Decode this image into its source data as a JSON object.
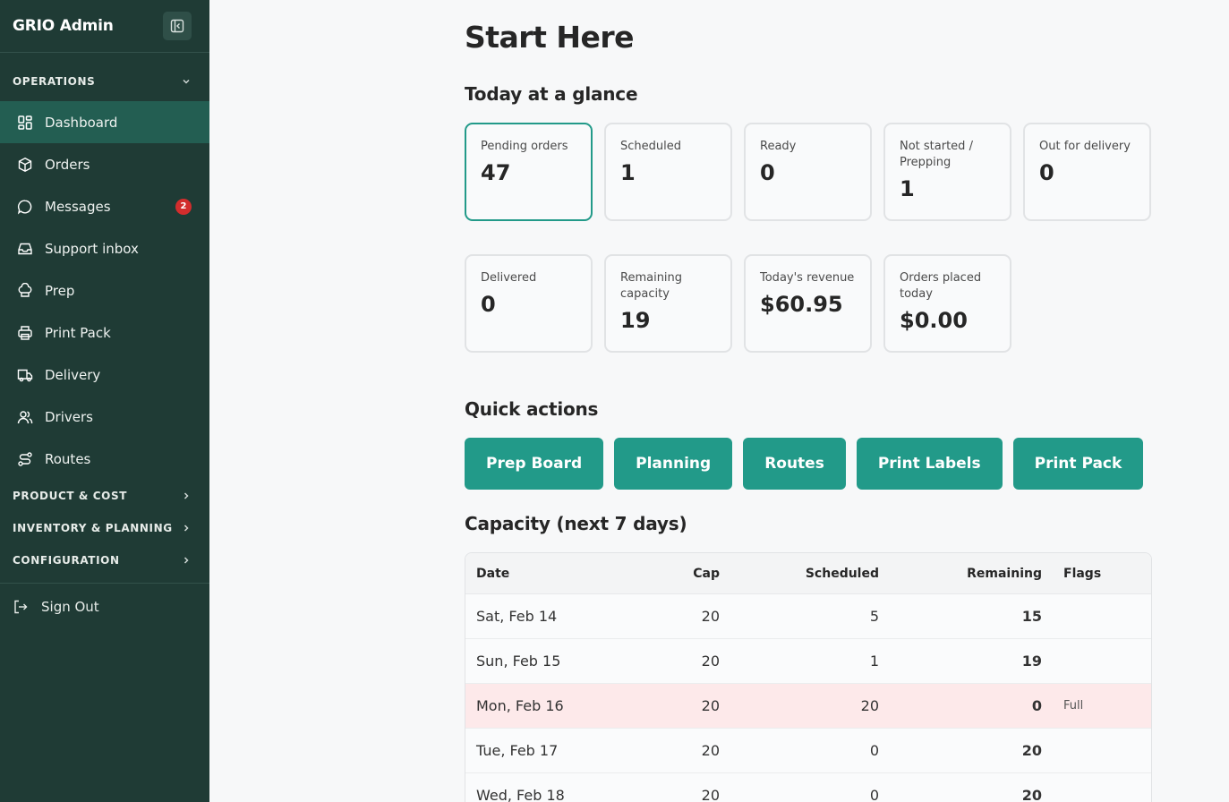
{
  "sidebar": {
    "brand": "GRIO Admin",
    "operations_label": "OPERATIONS",
    "items": [
      {
        "label": "Dashboard",
        "icon": "dashboard-icon"
      },
      {
        "label": "Orders",
        "icon": "box-icon"
      },
      {
        "label": "Messages",
        "icon": "chat-icon",
        "badge": "2"
      },
      {
        "label": "Support inbox",
        "icon": "inbox-icon"
      },
      {
        "label": "Prep",
        "icon": "chef-hat-icon"
      },
      {
        "label": "Print Pack",
        "icon": "printer-icon"
      },
      {
        "label": "Delivery",
        "icon": "truck-icon"
      },
      {
        "label": "Drivers",
        "icon": "users-icon"
      },
      {
        "label": "Routes",
        "icon": "route-icon"
      }
    ],
    "sections": [
      "PRODUCT & COST",
      "INVENTORY & PLANNING",
      "CONFIGURATION"
    ],
    "sign_out": "Sign Out",
    "active_color": "#235e52"
  },
  "page": {
    "title": "Start Here",
    "glance_heading": "Today at a glance",
    "cards": [
      {
        "label": "Pending orders",
        "value": "47"
      },
      {
        "label": "Scheduled",
        "value": "1"
      },
      {
        "label": "Ready",
        "value": "0"
      },
      {
        "label": "Not started / Prepping",
        "value": "1"
      },
      {
        "label": "Out for delivery",
        "value": "0"
      },
      {
        "label": "Delivered",
        "value": "0"
      },
      {
        "label": "Remaining capacity",
        "value": "19"
      },
      {
        "label": "Today's revenue",
        "value": "$60.95"
      },
      {
        "label": "Orders placed today",
        "value": "$0.00"
      }
    ],
    "quick_actions_heading": "Quick actions",
    "actions": [
      "Prep Board",
      "Planning",
      "Routes",
      "Print Labels",
      "Print Pack"
    ],
    "capacity_heading": "Capacity (next 7 days)",
    "table": {
      "headers": [
        "Date",
        "Cap",
        "Scheduled",
        "Remaining",
        "Flags"
      ],
      "rows": [
        {
          "date": "Sat, Feb 14",
          "cap": "20",
          "scheduled": "5",
          "remaining": "15",
          "flags": ""
        },
        {
          "date": "Sun, Feb 15",
          "cap": "20",
          "scheduled": "1",
          "remaining": "19",
          "flags": ""
        },
        {
          "date": "Mon, Feb 16",
          "cap": "20",
          "scheduled": "20",
          "remaining": "0",
          "flags": "Full"
        },
        {
          "date": "Tue, Feb 17",
          "cap": "20",
          "scheduled": "0",
          "remaining": "20",
          "flags": ""
        },
        {
          "date": "Wed, Feb 18",
          "cap": "20",
          "scheduled": "0",
          "remaining": "20",
          "flags": ""
        }
      ]
    },
    "accent_color": "#229a89",
    "full_row_color": "#fde9ea"
  }
}
